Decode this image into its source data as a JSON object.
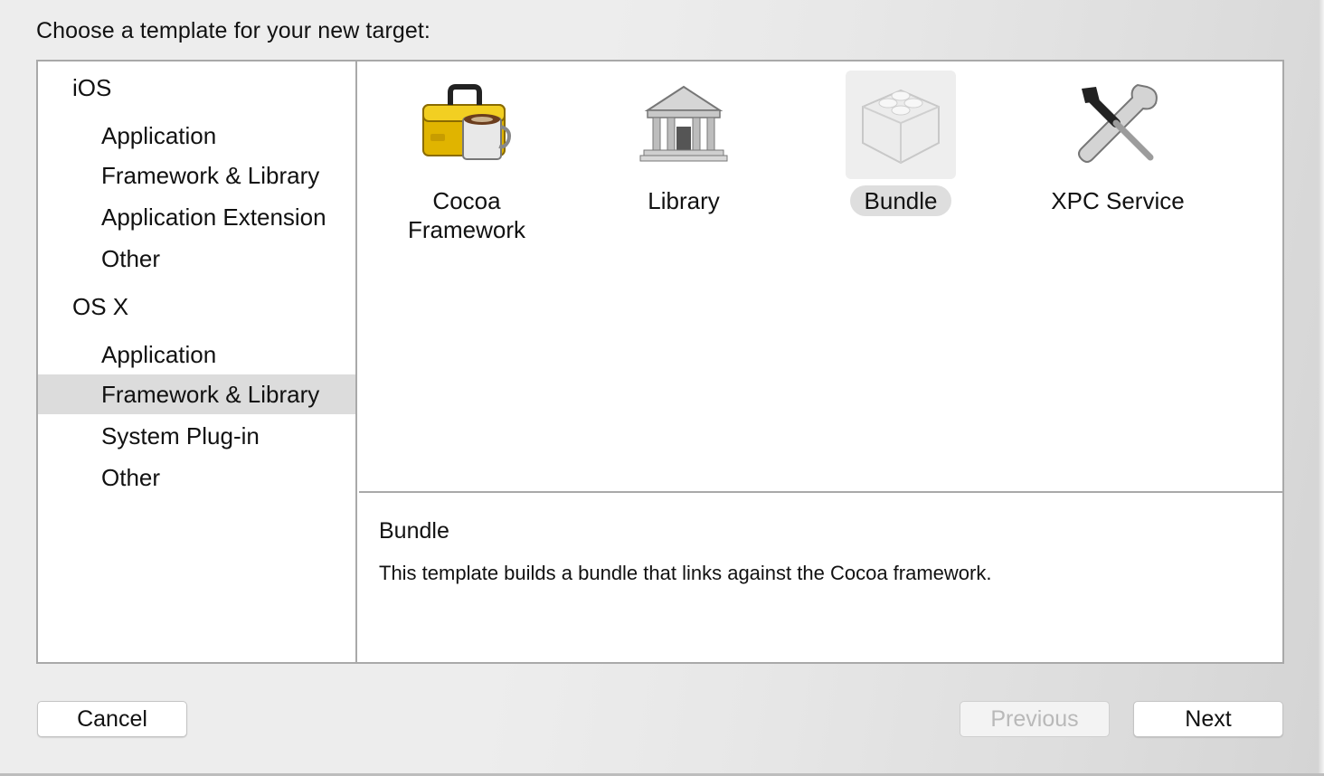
{
  "dialog": {
    "prompt": "Choose a template for your new target:"
  },
  "sidebar": {
    "sections": [
      {
        "title": "iOS",
        "items": [
          {
            "label": "Application"
          },
          {
            "label": "Framework & Library"
          },
          {
            "label": "Application Extension"
          },
          {
            "label": "Other"
          }
        ]
      },
      {
        "title": "OS X",
        "items": [
          {
            "label": "Application"
          },
          {
            "label": "Framework & Library",
            "selected": true
          },
          {
            "label": "System Plug-in"
          },
          {
            "label": "Other"
          }
        ]
      }
    ]
  },
  "templates": [
    {
      "line1": "Cocoa",
      "line2": "Framework",
      "icon": "toolbox-coffee-icon"
    },
    {
      "line1": "Library",
      "icon": "library-building-icon"
    },
    {
      "line1": "Bundle",
      "icon": "lego-brick-icon",
      "selected": true
    },
    {
      "line1": "XPC Service",
      "icon": "wrench-screwdriver-icon"
    }
  ],
  "description": {
    "title": "Bundle",
    "text": "This template builds a bundle that links against the Cocoa framework."
  },
  "buttons": {
    "cancel": "Cancel",
    "previous": "Previous",
    "next": "Next"
  },
  "colors": {
    "selection_gray": "#dcdcdc",
    "pane_border": "#a9a9a9",
    "disabled_text": "#b9b9b9"
  }
}
